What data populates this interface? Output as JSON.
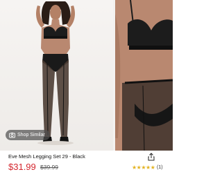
{
  "gallery": {
    "shop_similar_label": "Shop Similar"
  },
  "product": {
    "name": "Eve Mesh Legging Set 29 - Black",
    "sale_price": "$31.99",
    "original_price": "$39.99",
    "rating_stars": 4,
    "rating_display": "★★★★★",
    "review_count": "(1)"
  },
  "colors": {
    "sale_price": "#d4262e",
    "stars": "#e3b321"
  },
  "icons": {
    "shop_similar": "camera-icon",
    "share": "share-icon"
  }
}
